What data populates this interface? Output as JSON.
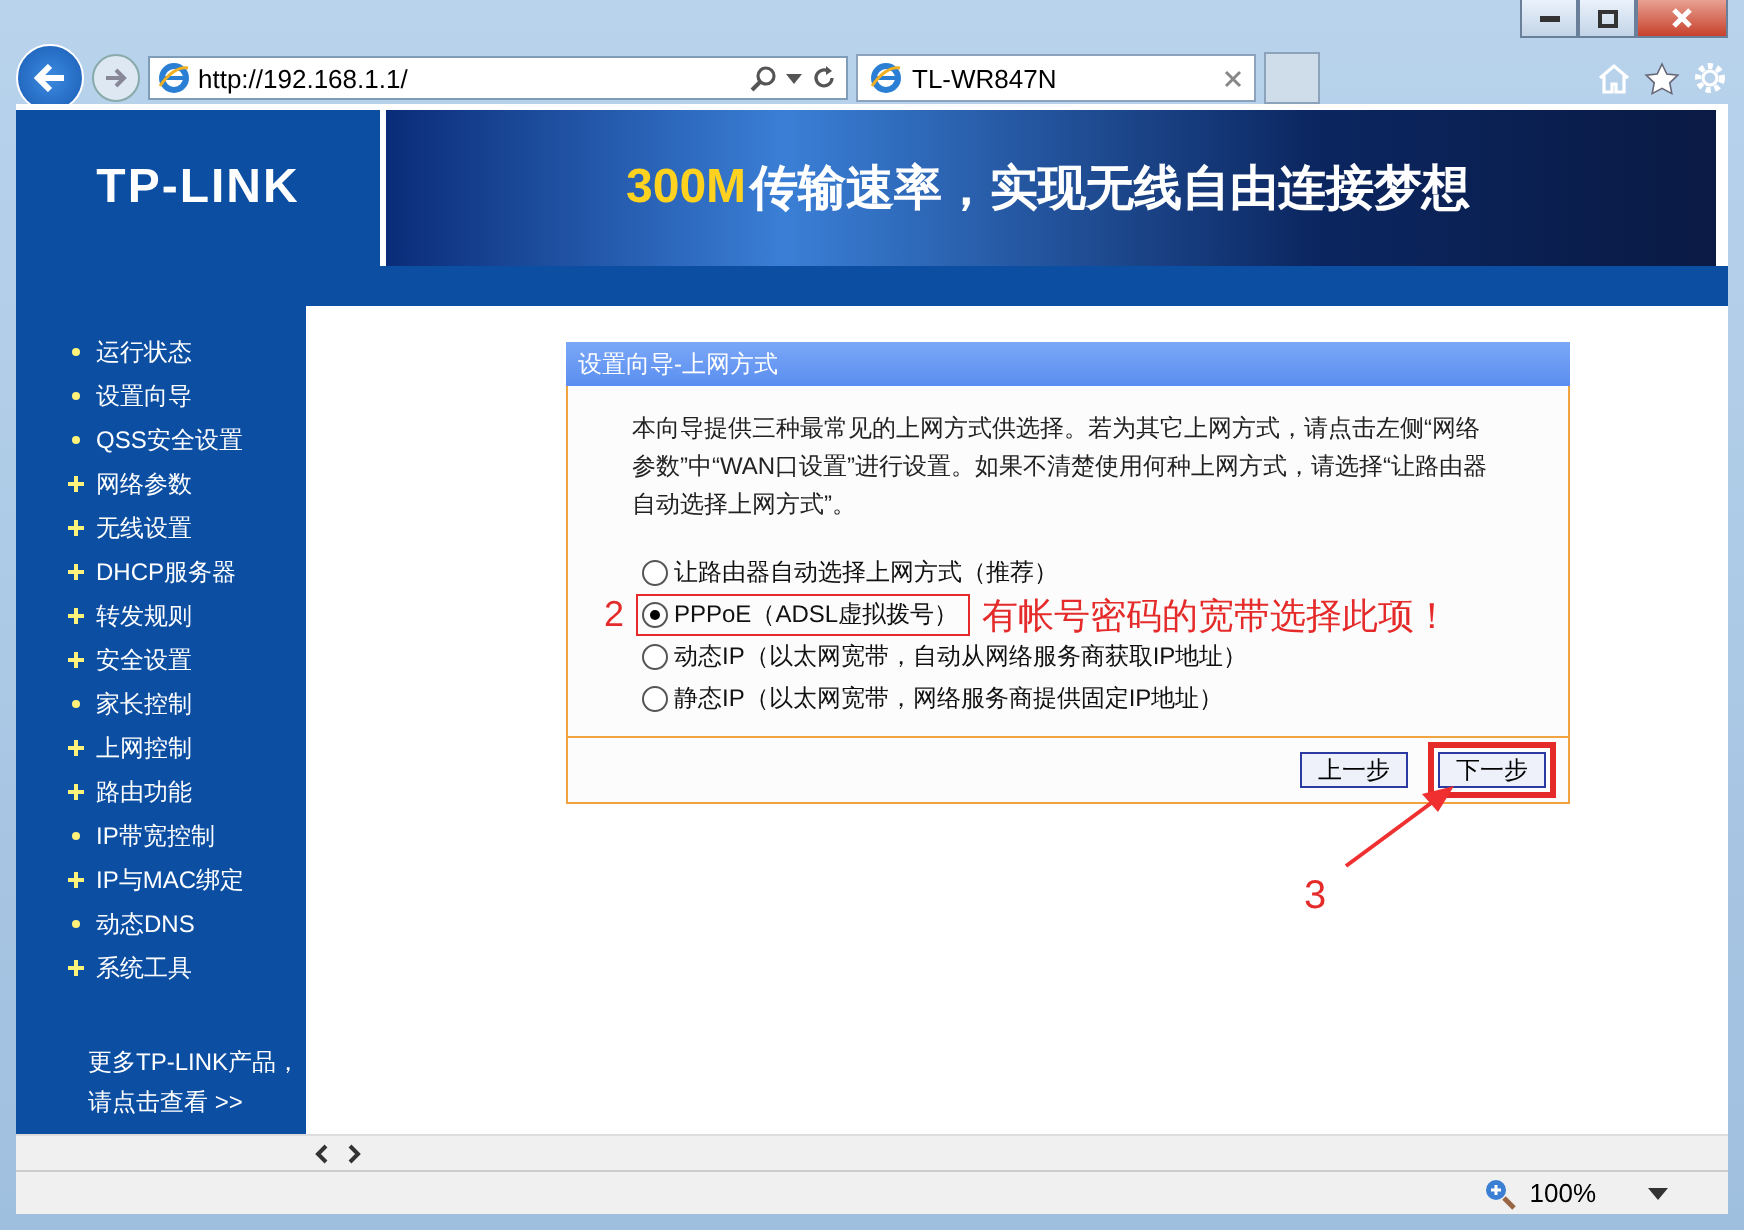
{
  "browser": {
    "address": "http://192.168.1.1/",
    "tab_title": "TL-WR847N",
    "zoom": "100%"
  },
  "header": {
    "logo": "TP-LINK",
    "banner_highlight": "300M",
    "banner_slogan": "传输速率，实现无线自由连接梦想"
  },
  "sidebar": {
    "items": [
      {
        "label": "运行状态",
        "kind": "dot"
      },
      {
        "label": "设置向导",
        "kind": "dot"
      },
      {
        "label": "QSS安全设置",
        "kind": "dot"
      },
      {
        "label": "网络参数",
        "kind": "plus"
      },
      {
        "label": "无线设置",
        "kind": "plus"
      },
      {
        "label": "DHCP服务器",
        "kind": "plus"
      },
      {
        "label": "转发规则",
        "kind": "plus"
      },
      {
        "label": "安全设置",
        "kind": "plus"
      },
      {
        "label": "家长控制",
        "kind": "dot"
      },
      {
        "label": "上网控制",
        "kind": "plus"
      },
      {
        "label": "路由功能",
        "kind": "plus"
      },
      {
        "label": "IP带宽控制",
        "kind": "dot"
      },
      {
        "label": "IP与MAC绑定",
        "kind": "plus"
      },
      {
        "label": "动态DNS",
        "kind": "dot"
      },
      {
        "label": "系统工具",
        "kind": "plus"
      }
    ],
    "more_line_1": "更多TP-LINK产品，",
    "more_line_2": "请点击查看 >>"
  },
  "wizard": {
    "title": "设置向导-上网方式",
    "intro": "本向导提供三种最常见的上网方式供选择。若为其它上网方式，请点击左侧“网络参数”中“WAN口设置”进行设置。如果不清楚使用何种上网方式，请选择“让路由器自动选择上网方式”。",
    "options": [
      {
        "label": "让路由器自动选择上网方式（推荐）",
        "selected": false,
        "highlighted": false
      },
      {
        "label": "PPPoE（ADSL虚拟拨号）",
        "selected": true,
        "highlighted": true,
        "step": "2",
        "note": "有帐号密码的宽带选择此项！"
      },
      {
        "label": "动态IP（以太网宽带，自动从网络服务商获取IP地址）",
        "selected": false,
        "highlighted": false
      },
      {
        "label": "静态IP（以太网宽带，网络服务商提供固定IP地址）",
        "selected": false,
        "highlighted": false
      }
    ],
    "buttons": [
      {
        "label": "上一步",
        "highlighted": false
      },
      {
        "label": "下一步",
        "highlighted": true,
        "step": "3"
      }
    ]
  }
}
